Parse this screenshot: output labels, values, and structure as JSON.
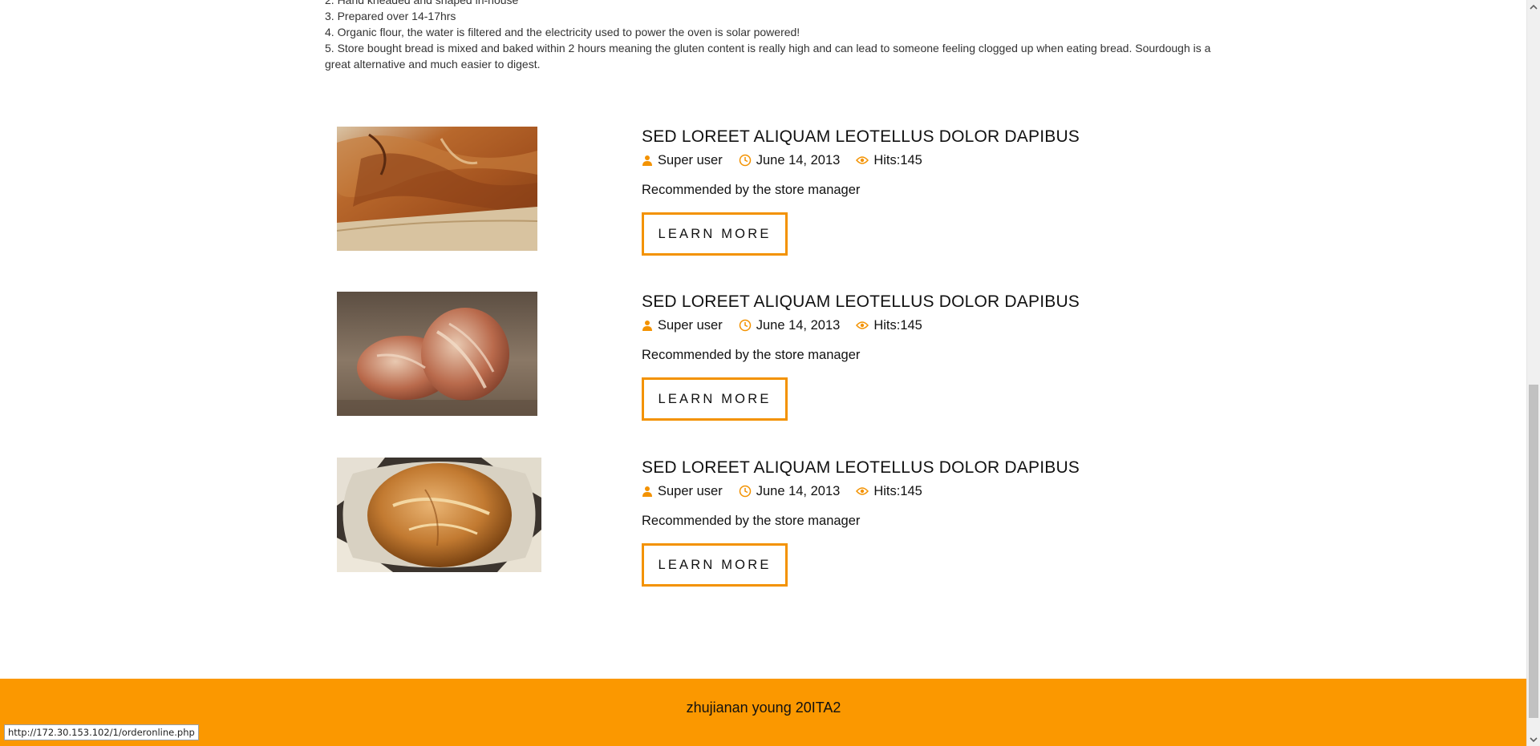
{
  "intro": {
    "lines": [
      "2. Hand kneaded and shaped in-house",
      "3. Prepared over 14-17hrs",
      "4. Organic flour, the water is filtered and the electricity used to power the oven is solar powered!",
      "5. Store bought bread is mixed and baked within 2 hours meaning the gluten content is really high and can lead to someone feeling clogged up when eating bread. Sourdough is a great alternative and much easier to digest."
    ]
  },
  "articles": [
    {
      "title": "SED LOREET ALIQUAM LEOTELLUS DOLOR DAPIBUS",
      "author": "Super user",
      "date": "June 14, 2013",
      "hits": "Hits:145",
      "summary": "Recommended by the store manager",
      "button": "LEARN MORE",
      "image": "bread-crust-closeup"
    },
    {
      "title": "SED LOREET ALIQUAM LEOTELLUS DOLOR DAPIBUS",
      "author": "Super user",
      "date": "June 14, 2013",
      "hits": "Hits:145",
      "summary": "Recommended by the store manager",
      "button": "LEARN MORE",
      "image": "two-sourdough-loaves"
    },
    {
      "title": "SED LOREET ALIQUAM LEOTELLUS DOLOR DAPIBUS",
      "author": "Super user",
      "date": "June 14, 2013",
      "hits": "Hits:145",
      "summary": "Recommended by the store manager",
      "button": "LEARN MORE",
      "image": "round-loaf-in-paper"
    }
  ],
  "footer": {
    "text": "zhujianan young 20ITA2"
  },
  "status_bar": {
    "url": "http://172.30.153.102/1/orderonline.php"
  },
  "colors": {
    "accent": "#f39200",
    "footer_bg": "#fb9800"
  },
  "icons": {
    "author": "user-icon",
    "date": "clock-icon",
    "hits": "eye-icon"
  }
}
